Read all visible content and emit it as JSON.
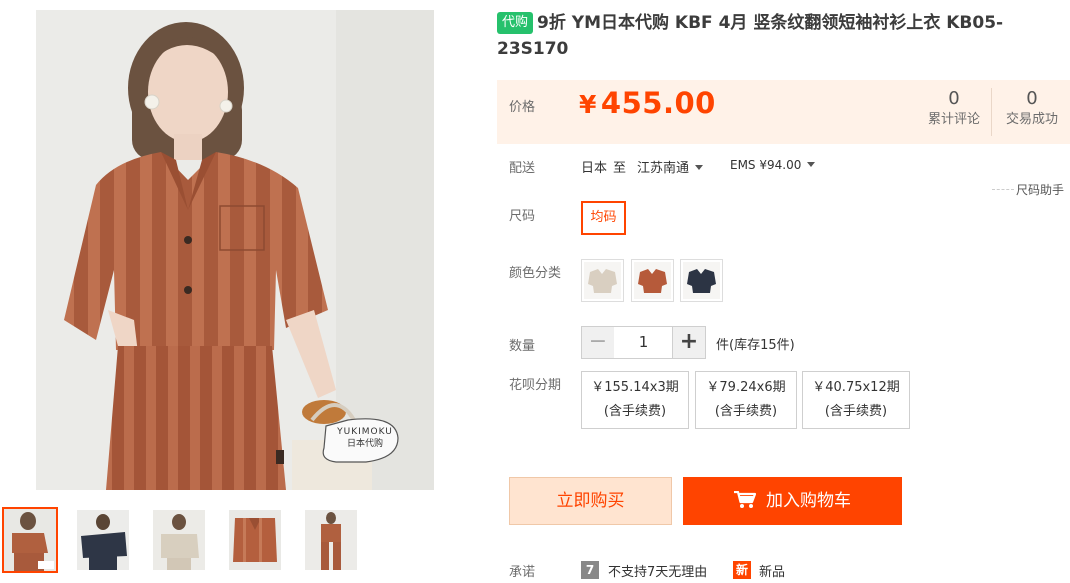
{
  "title": {
    "tag": "代购",
    "text": "9折 YM日本代购 KBF 4月 竖条纹翻领短袖衬衫上衣 KB05-23S170"
  },
  "price": {
    "label": "价格",
    "currency": "¥",
    "amount": "455.00",
    "stats": [
      {
        "num": "0",
        "label": "累计评论"
      },
      {
        "num": "0",
        "label": "交易成功"
      }
    ]
  },
  "shipping": {
    "label": "配送",
    "from": "日本",
    "to_word": "至",
    "to": "江苏南通",
    "method": "EMS ¥94.00"
  },
  "size_helper": "尺码助手",
  "size": {
    "label": "尺码",
    "options": [
      "均码"
    ]
  },
  "color": {
    "label": "颜色分类",
    "swatches": [
      {
        "name": "beige",
        "hex": "#d9cfc1"
      },
      {
        "name": "brown-orange",
        "hex": "#b65a3a"
      },
      {
        "name": "navy",
        "hex": "#2c3444"
      }
    ]
  },
  "quantity": {
    "label": "数量",
    "value": "1",
    "minus": "−",
    "plus": "+",
    "stock_text": "件(库存15件)"
  },
  "installment": {
    "label": "花呗分期",
    "options": [
      {
        "amount": "￥155.14x3期",
        "fee": "(含手续费)"
      },
      {
        "amount": "￥79.24x6期",
        "fee": "(含手续费)"
      },
      {
        "amount": "￥40.75x12期",
        "fee": "(含手续费)"
      }
    ]
  },
  "actions": {
    "buy_now": "立即购买",
    "add_cart": "加入购物车"
  },
  "promise": {
    "label": "承诺",
    "items": [
      {
        "icon_text": "7",
        "text": "不支持7天无理由"
      },
      {
        "icon_text": "新",
        "text": "新品"
      }
    ]
  },
  "photo_watermark": [
    "YUKIMOKU",
    "日本代购"
  ],
  "colors": {
    "accent": "#ff4400",
    "price_bg": "#fff2e8",
    "daigou_green": "#26c16c"
  }
}
